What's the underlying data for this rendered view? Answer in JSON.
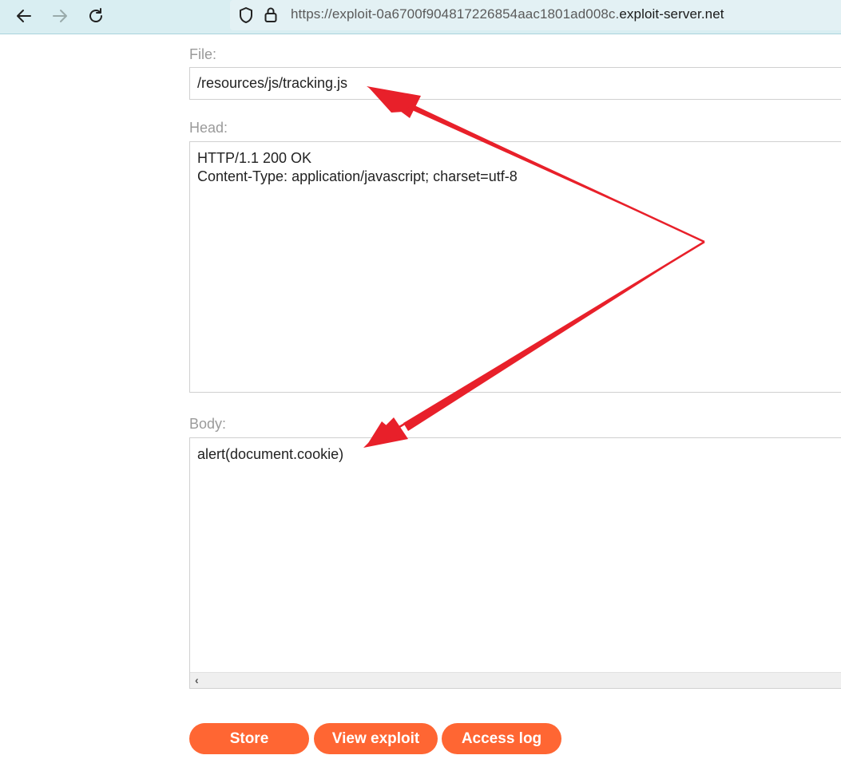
{
  "browser": {
    "url_prefix": "https://exploit-0a6700f904817226854aac1801ad008c.",
    "url_domain": "exploit-server.net"
  },
  "form": {
    "file_label": "File:",
    "file_value": "/resources/js/tracking.js",
    "head_label": "Head:",
    "head_value": "HTTP/1.1 200 OK\nContent-Type: application/javascript; charset=utf-8",
    "body_label": "Body:",
    "body_value": "alert(document.cookie)"
  },
  "buttons": {
    "store": "Store",
    "view_exploit": "View exploit",
    "access_log": "Access log"
  },
  "colors": {
    "button": "#ff6633",
    "annotation_arrow": "#e8202a",
    "toolbar": "#d9eef2"
  },
  "icons": [
    "back-arrow-icon",
    "forward-arrow-icon",
    "reload-icon",
    "shield-icon",
    "lock-icon",
    "chevron-left-icon"
  ]
}
